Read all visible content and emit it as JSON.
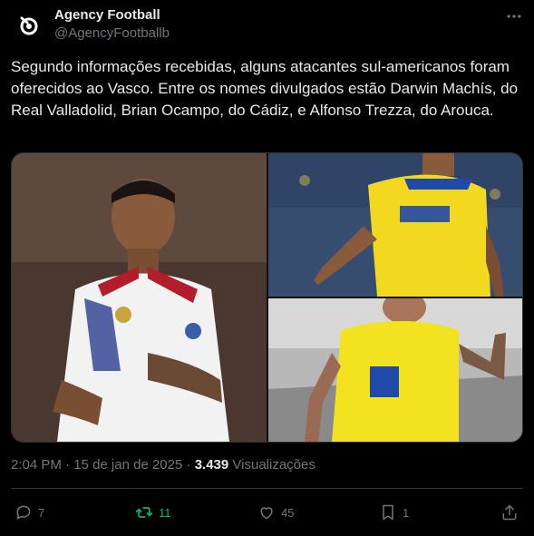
{
  "tweet": {
    "author_name": "Agency Football",
    "author_handle": "@AgencyFootballb",
    "more_icon": "more-horizontal-icon",
    "body": "Segundo informações recebidas, alguns atacantes sul-americanos foram oferecidos ao Vasco. Entre os nomes divulgados estão Darwin Machís, do Real Valladolid, Brian Ocampo, do Cádiz, e Alfonso Trezza, do Arouca.",
    "time": "2:04 PM",
    "date": "15 de jan de 2025",
    "separator": "·",
    "views_count": "3.439",
    "views_label": "Visualizações"
  },
  "media": {
    "photos": [
      {
        "name": "player-venezuela-photo"
      },
      {
        "name": "player-cadiz-blue-shirt-photo"
      },
      {
        "name": "player-cadiz-yellow-shirt-photo"
      }
    ]
  },
  "actions": {
    "reply_count": "7",
    "retweet_count": "11",
    "like_count": "45",
    "bookmark_count": "1"
  },
  "colors": {
    "background": "#000000",
    "text": "#e7e9ea",
    "muted": "#71767b",
    "retweet_active": "#00ba7c",
    "border": "#2f3336"
  }
}
